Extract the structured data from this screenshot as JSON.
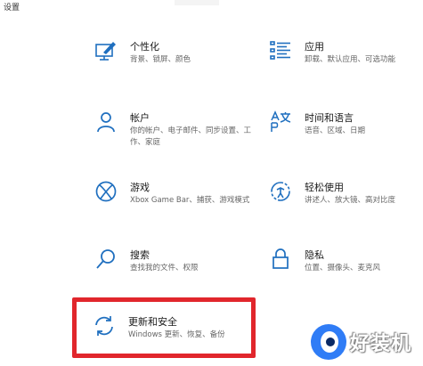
{
  "window": {
    "title": "设置"
  },
  "tiles": [
    {
      "name": "个性化",
      "desc": "背景、锁屏、颜色",
      "icon": "personalization-icon"
    },
    {
      "name": "应用",
      "desc": "卸载、默认应用、可选功能",
      "icon": "apps-icon"
    },
    {
      "name": "帐户",
      "desc": "你的帐户、电子邮件、同步设置、工作、家庭",
      "icon": "account-icon"
    },
    {
      "name": "时间和语言",
      "desc": "语音、区域、日期",
      "icon": "time-language-icon"
    },
    {
      "name": "游戏",
      "desc": "Xbox Game Bar、捕获、游戏模式",
      "icon": "xbox-icon"
    },
    {
      "name": "轻松使用",
      "desc": "讲述人、放大镜、高对比度",
      "icon": "ease-of-access-icon"
    },
    {
      "name": "搜索",
      "desc": "查找我的文件、权限",
      "icon": "search-icon"
    },
    {
      "name": "隐私",
      "desc": "位置、摄像头、麦克风",
      "icon": "lock-icon"
    },
    {
      "name": "更新和安全",
      "desc": "Windows 更新、恢复、备份",
      "icon": "update-icon"
    }
  ],
  "highlight": {
    "color": "#e1262c"
  },
  "accent": "#1f6fbf",
  "watermark": {
    "text": "好装机"
  }
}
